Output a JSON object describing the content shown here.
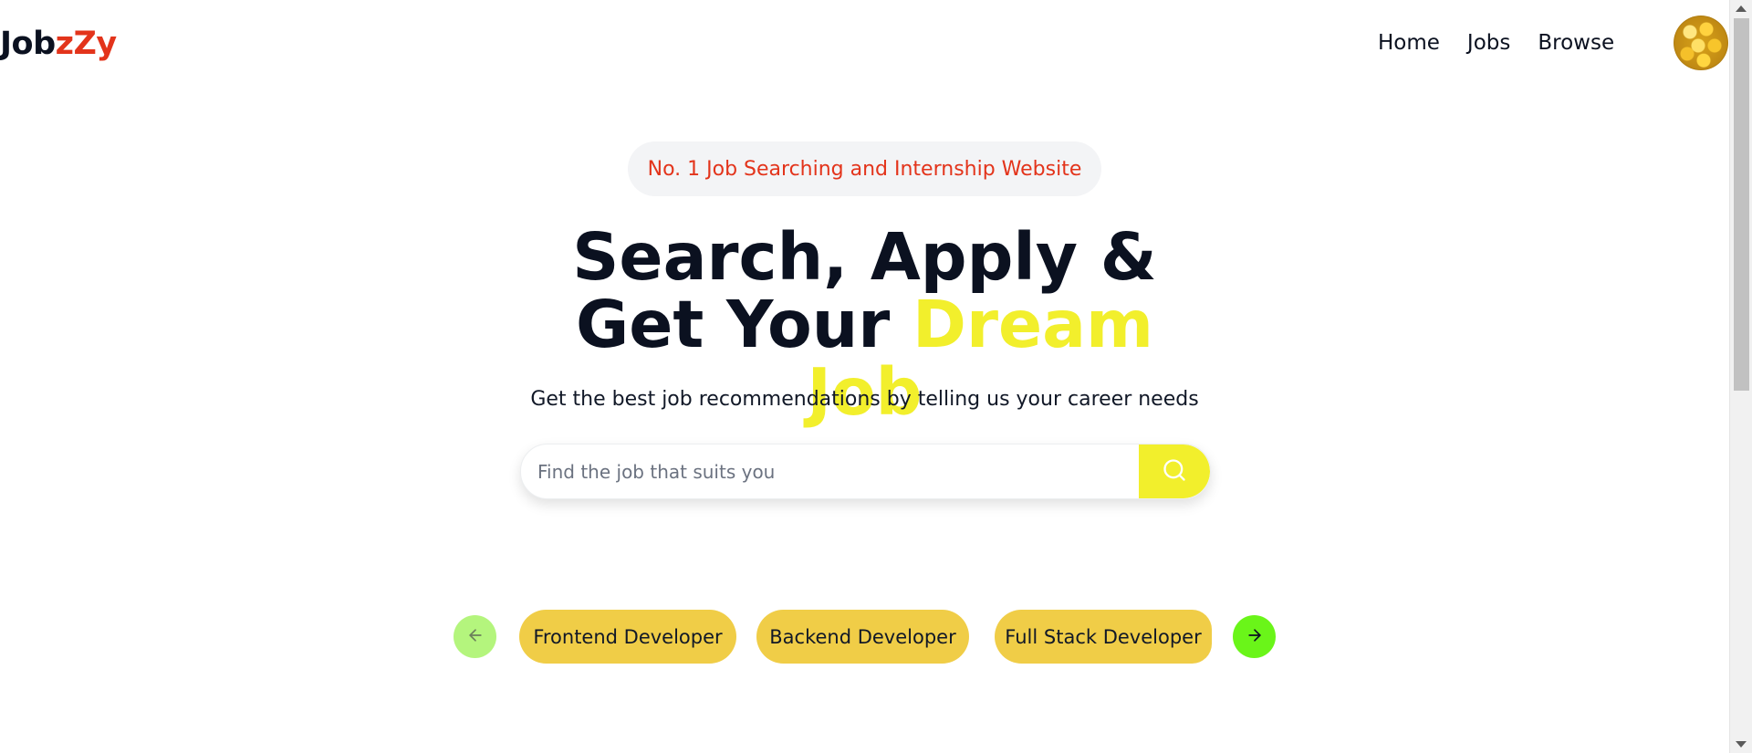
{
  "navbar": {
    "logo_part1": "Job",
    "logo_part2": "zZy",
    "links": [
      "Home",
      "Jobs",
      "Browse"
    ]
  },
  "hero": {
    "badge": "No. 1 Job Searching and Internship Website",
    "headline_line1": "Search, Apply &",
    "headline_line2_prefix": "Get Your ",
    "headline_highlight": "Dream Job",
    "subtitle": "Get the best job recommendations by telling us your career needs"
  },
  "search": {
    "placeholder": "Find the job that suits you",
    "value": ""
  },
  "carousel": {
    "categories": [
      "Frontend Developer",
      "Backend Developer",
      "Full Stack Developer"
    ]
  },
  "colors": {
    "logo_accent": "#e3341b",
    "highlight_yellow": "#f2ef2c",
    "chip_yellow": "#f0cd47",
    "prev_green": "#b4f57d",
    "next_green": "#6af519"
  },
  "icons": {
    "search_button": "search-icon",
    "prev": "arrow-left-icon",
    "next": "arrow-right-icon"
  }
}
